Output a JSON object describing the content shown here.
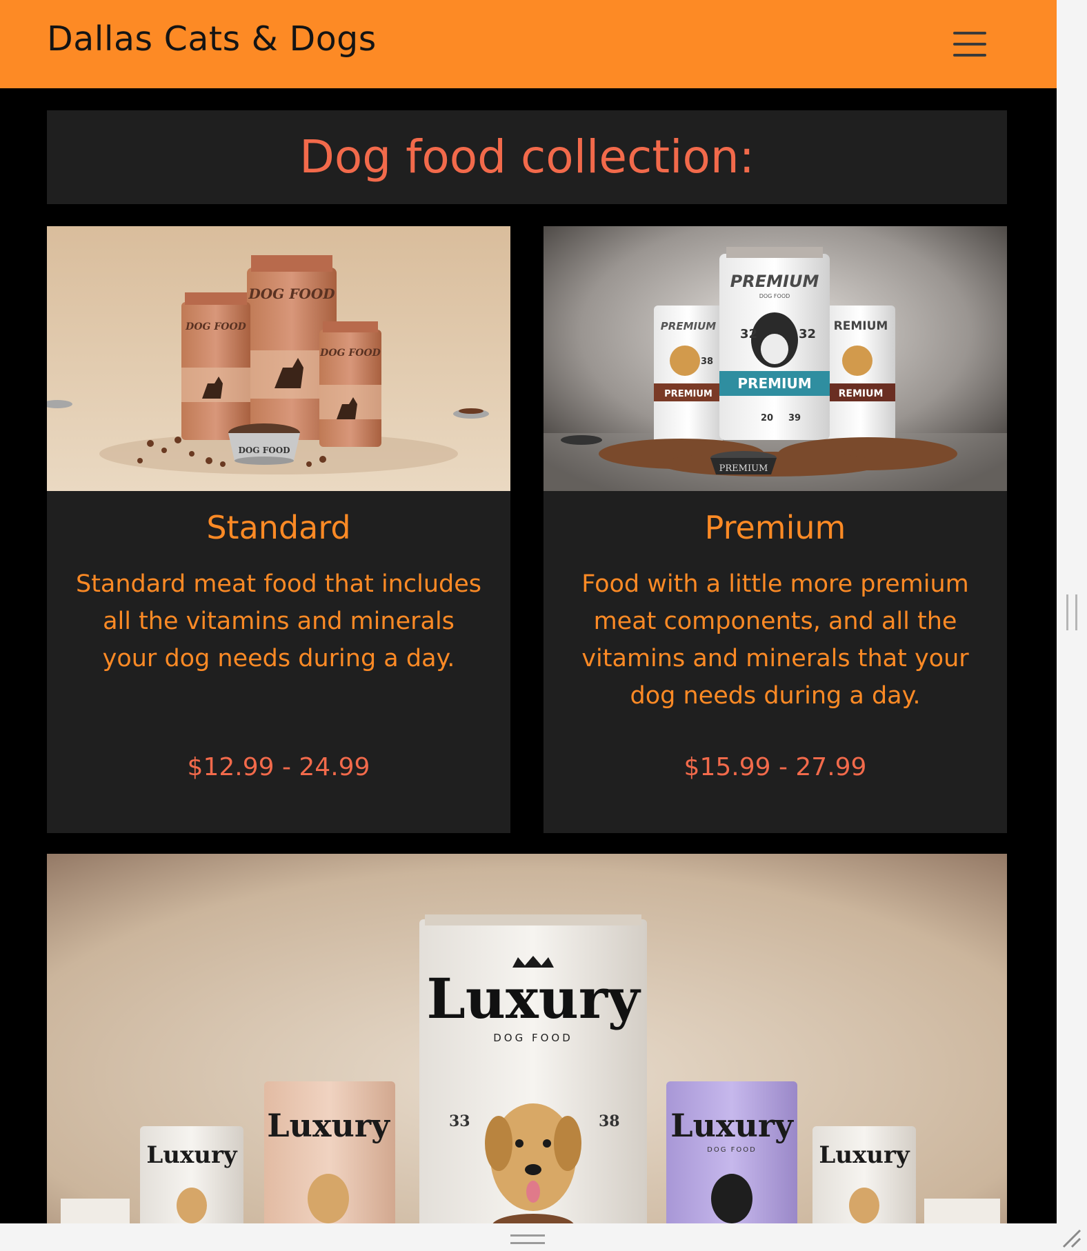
{
  "navbar": {
    "brand": "Dallas Cats & Dogs",
    "menu_icon": "hamburger-menu-icon",
    "background_color": "#fd8a25"
  },
  "section": {
    "heading": "Dog food collection:"
  },
  "products": [
    {
      "name": "Standard",
      "description": "Standard meat food that includes all the vitamins and minerals your dog needs during a day.",
      "price": "$12.99 - 24.99",
      "image": {
        "bag_big_label": "DOG FOOD",
        "bag_left_label": "DOG FOOD",
        "bag_right_label": "DOG FOOD",
        "bowl_label": "DOG FOOD"
      }
    },
    {
      "name": "Premium",
      "description": "Food with a little more premium meat components, and all the vitamins and minerals that your dog needs during a day.",
      "price": "$15.99 - 27.99",
      "image": {
        "bag_center_brand": "PREMIUM",
        "bag_center_sub": "DOG FOOD",
        "bag_left_brand": "PREMIUM",
        "bag_right_brand": "REMIUM",
        "band_center": "PREMIUM",
        "band_left": "PREMIUM",
        "band_right": "REMIUM",
        "bowl_label": "PREMIUM",
        "num_a": "32",
        "num_b": "38",
        "num_c": "20",
        "num_d": "39"
      }
    }
  ],
  "luxury_banner": {
    "brand": "Luxury",
    "sub": "DOG FOOD",
    "num_a": "33",
    "num_b": "38",
    "bag_purple_sub": "DOG FOOD"
  },
  "colors": {
    "page_background": "#000000",
    "panel_background": "#1f1f1f",
    "accent_orange": "#fd8a25",
    "accent_coral": "#f26a4b"
  }
}
